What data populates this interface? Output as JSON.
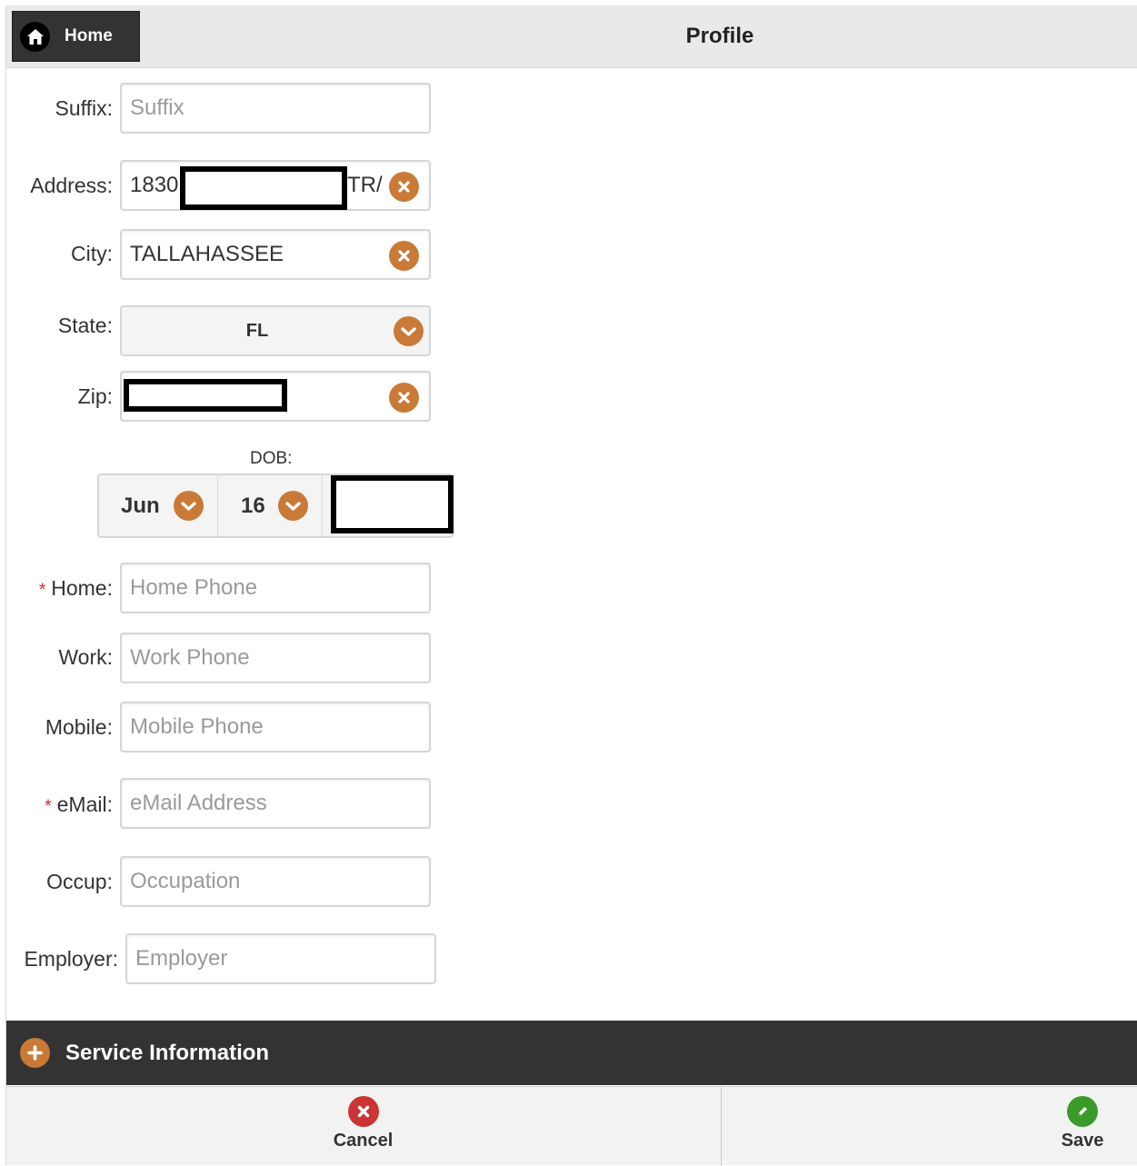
{
  "header": {
    "home_label": "Home",
    "title": "Profile"
  },
  "form": {
    "suffix": {
      "label": "Suffix:",
      "placeholder": "Suffix",
      "value": ""
    },
    "address": {
      "label": "Address:",
      "value_prefix": "1830",
      "value_suffix": "TR/"
    },
    "city": {
      "label": "City:",
      "value": "TALLAHASSEE"
    },
    "state": {
      "label": "State:",
      "value": "FL"
    },
    "zip": {
      "label": "Zip:"
    },
    "dob": {
      "label": "DOB:",
      "month": "Jun",
      "day": "16"
    },
    "home": {
      "required_mark": "*",
      "label": "Home:",
      "placeholder": "Home Phone"
    },
    "work": {
      "label": "Work:",
      "placeholder": "Work Phone"
    },
    "mobile": {
      "label": "Mobile:",
      "placeholder": "Mobile Phone"
    },
    "email": {
      "required_mark": "*",
      "label": "eMail:",
      "placeholder": "eMail Address"
    },
    "occup": {
      "label": "Occup:",
      "placeholder": "Occupation"
    },
    "employer": {
      "label": "Employer:",
      "placeholder": "Employer"
    }
  },
  "service_bar": {
    "label": "Service Information"
  },
  "footer": {
    "cancel_label": "Cancel",
    "save_label": "Save"
  },
  "colors": {
    "accent": "#c97a37",
    "dark_bar": "#333333",
    "required": "#dd2222",
    "cancel": "#cc3333",
    "save": "#3a9a2a"
  },
  "icons": {
    "home": "home-icon",
    "clear": "clear-circle-icon",
    "chevron": "chevron-down-icon",
    "plus": "plus-circle-icon",
    "cancel": "cancel-circle-icon",
    "save": "pencil-circle-icon"
  }
}
